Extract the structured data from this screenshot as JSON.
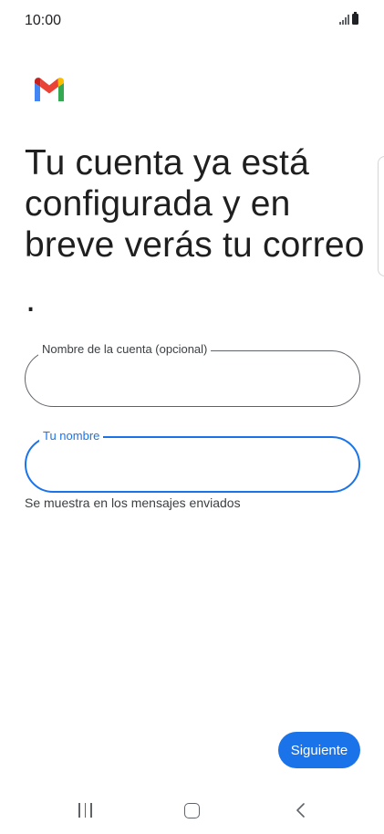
{
  "status_bar": {
    "time": "10:00"
  },
  "icons": {
    "logo": "gmail-logo-icon",
    "signal": "signal-icon",
    "battery": "battery-icon",
    "recents": "recent-apps-icon",
    "home": "home-icon",
    "back": "back-icon"
  },
  "headline": {
    "text": "Tu cuenta ya está configurada y en breve verás tu correo",
    "dot": "."
  },
  "form": {
    "account_name": {
      "label": "Nombre de la cuenta (opcional)",
      "value": "",
      "placeholder": ""
    },
    "your_name": {
      "label": "Tu nombre",
      "value": "",
      "placeholder": "",
      "helper": "Se muestra en los mensajes enviados"
    }
  },
  "actions": {
    "next_label": "Siguiente"
  },
  "colors": {
    "accent": "#1a73e8",
    "gmail_red": "#ea4335",
    "gmail_blue": "#4285f4",
    "gmail_green": "#34a853",
    "gmail_yellow": "#fbbc04",
    "gmail_dark_red": "#c5221f"
  }
}
